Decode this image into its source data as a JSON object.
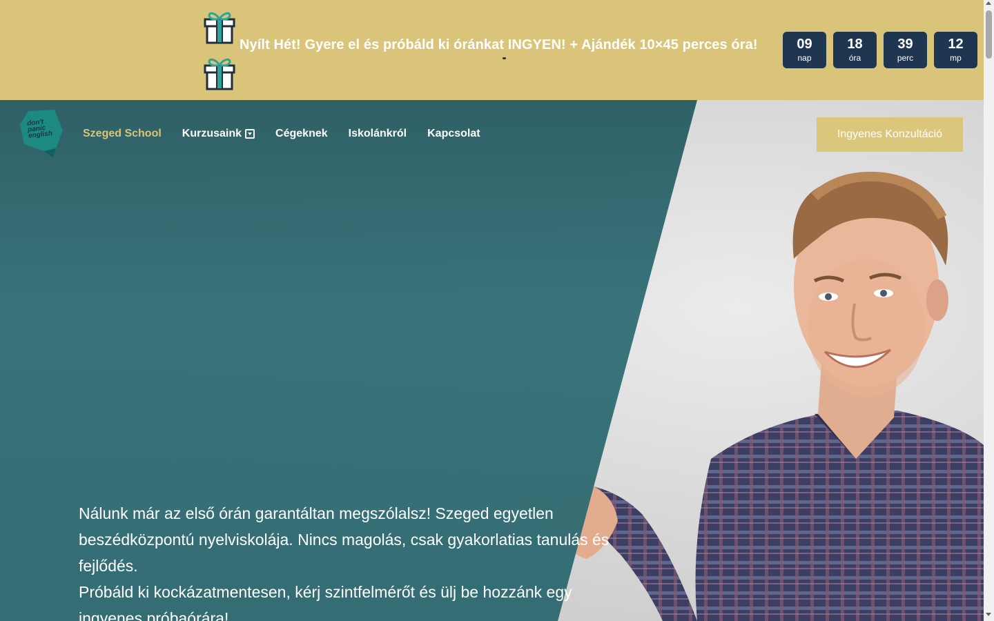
{
  "promo": {
    "text": "Nyílt Hét! Gyere el és próbáld ki óránkat INGYEN! + Ajándék 10×45 perces óra!",
    "countdown": [
      {
        "value": "09",
        "unit": "nap"
      },
      {
        "value": "18",
        "unit": "óra"
      },
      {
        "value": "39",
        "unit": "perc"
      },
      {
        "value": "12",
        "unit": "mp"
      }
    ],
    "background_color": "#d9c47a",
    "countdown_color": "#1f3650",
    "icon": "gift-icon"
  },
  "logo": {
    "lines": [
      "don't",
      "panic",
      "english"
    ],
    "color": "#1d8a82"
  },
  "nav": {
    "items": [
      {
        "label": "Szeged School",
        "active": true
      },
      {
        "label": "Kurzusaink",
        "dropdown": true
      },
      {
        "label": "Cégeknek"
      },
      {
        "label": "Iskolánkról"
      },
      {
        "label": "Kapcsolat"
      }
    ],
    "cta": "Ingyenes Konzultáció"
  },
  "hero": {
    "paragraph1": "Nálunk már az első órán garantáltan megszólalsz! Szeged egyetlen beszédközpontú nyelviskolája. Nincs magolás, csak gyakorlatias tanulás és fejlődés.",
    "paragraph2": "Próbáld ki kockázatmentesen, kérj szintfelmérőt és ülj be hozzánk egy ingyenes próbaórára!",
    "teal_color": "#2e6870",
    "accent_color": "#d9c47a"
  }
}
